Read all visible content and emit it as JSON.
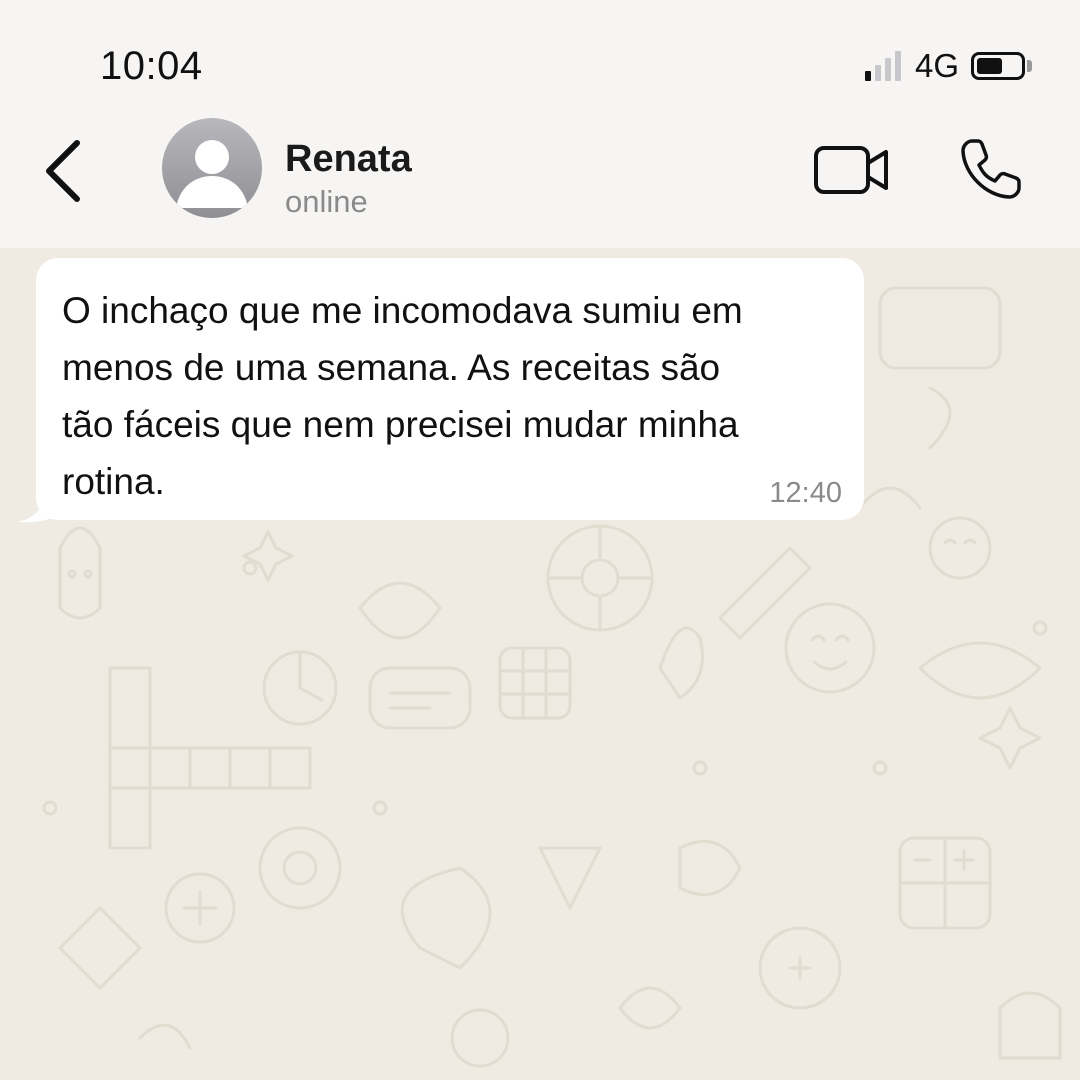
{
  "status_bar": {
    "time": "10:04",
    "network": "4G",
    "signal_bars": 4,
    "signal_bars_active": 1,
    "battery_level": 0.6
  },
  "header": {
    "contact_name": "Renata",
    "contact_status": "online",
    "icons": {
      "back": "chevron-left-icon",
      "avatar": "user-placeholder-icon",
      "video": "video-camera-icon",
      "voice": "phone-icon"
    }
  },
  "messages": [
    {
      "direction": "incoming",
      "text": "O inchaço que me incomodava sumiu em\nmenos de uma semana. As receitas são\ntão fáceis que nem precisei mudar minha\nrotina.",
      "time": "12:40"
    }
  ],
  "colors": {
    "header_bg": "#f6f5f3",
    "chat_bg": "#efeae2",
    "bubble_incoming": "#ffffff",
    "secondary_text": "#8a8a8a"
  }
}
